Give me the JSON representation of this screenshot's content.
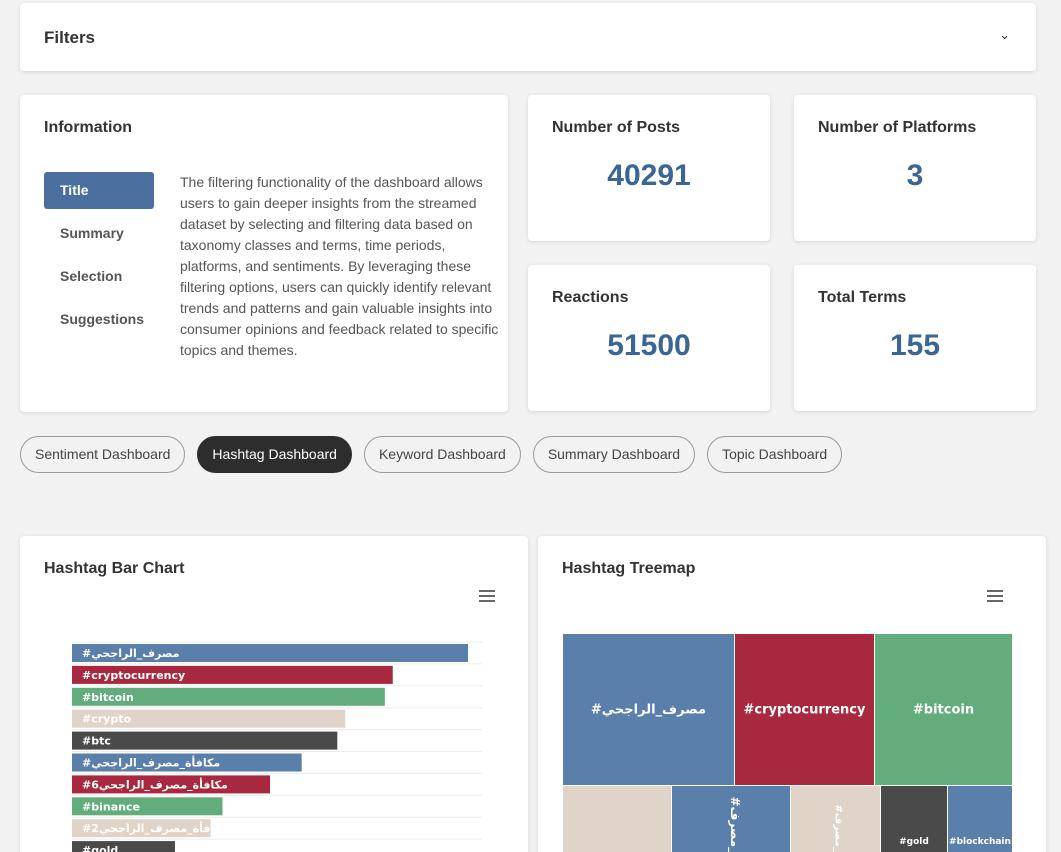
{
  "filters": {
    "title": "Filters",
    "chevron": "⌄"
  },
  "information": {
    "title": "Information",
    "tabs": [
      "Title",
      "Summary",
      "Selection",
      "Suggestions"
    ],
    "active_tab": "Title",
    "text": "The filtering functionality of the dashboard allows users to gain deeper insights from the streamed dataset by selecting and filtering data based on taxonomy classes and terms, time periods, platforms, and sentiments. By leveraging these filtering options, users can quickly identify relevant trends and patterns and gain valuable insights into consumer opinions and feedback related to specific topics and themes."
  },
  "stats": {
    "posts": {
      "label": "Number of Posts",
      "value": "40291"
    },
    "platforms": {
      "label": "Number of Platforms",
      "value": "3"
    },
    "reactions": {
      "label": "Reactions",
      "value": "51500"
    },
    "terms": {
      "label": "Total Terms",
      "value": "155"
    }
  },
  "dashboard_tabs": [
    "Sentiment Dashboard",
    "Hashtag Dashboard",
    "Keyword Dashboard",
    "Summary Dashboard",
    "Topic Dashboard"
  ],
  "active_dashboard_tab": "Hashtag Dashboard",
  "bar_card": {
    "title": "Hashtag Bar Chart",
    "menu_icon": "hamburger-menu-icon"
  },
  "tree_card": {
    "title": "Hashtag Treemap",
    "menu_icon": "hamburger-menu-icon"
  },
  "colors": {
    "blue": "#5b7fab",
    "red": "#a8293f",
    "green": "#63ad7d",
    "beige": "#e0d3c7",
    "dark": "#4a4a4a",
    "accent": "#3a6594"
  },
  "chart_data": [
    {
      "type": "bar",
      "orientation": "horizontal",
      "categories": [
        "#مصرف_الراجحي",
        "#cryptocurrency",
        "#bitcoin",
        "#crypto",
        "#btc",
        "#مكافأة_مصرف_الراجحي",
        "#مكافأة_مصرف_الراجحي6",
        "#binance",
        "#مكافأة_مصرف_الراجحي2",
        "#gold"
      ],
      "values": [
        100,
        81,
        79,
        69,
        67,
        58,
        50,
        38,
        35,
        26
      ],
      "bar_colors": [
        "#5b7fab",
        "#a8293f",
        "#63ad7d",
        "#e0d3c7",
        "#4a4a4a",
        "#5b7fab",
        "#a8293f",
        "#63ad7d",
        "#e0d3c7",
        "#4a4a4a"
      ],
      "title": "",
      "xlabel": "",
      "ylabel": ""
    },
    {
      "type": "treemap",
      "items": [
        {
          "label": "#مصرف_الراجحي",
          "color": "#5b7fab"
        },
        {
          "label": "#cryptocurrency",
          "color": "#a8293f"
        },
        {
          "label": "#bitcoin",
          "color": "#63ad7d"
        },
        {
          "label": "",
          "color": "#e0d3c7"
        },
        {
          "label": "#مكافأة_مصرف",
          "color": "#5b7fab"
        },
        {
          "label": "#مكافأة_مصرف",
          "color": "#e0d3c7"
        },
        {
          "label": "#gold",
          "color": "#4a4a4a"
        },
        {
          "label": "#blockchain",
          "color": "#5b7fab"
        }
      ]
    }
  ]
}
